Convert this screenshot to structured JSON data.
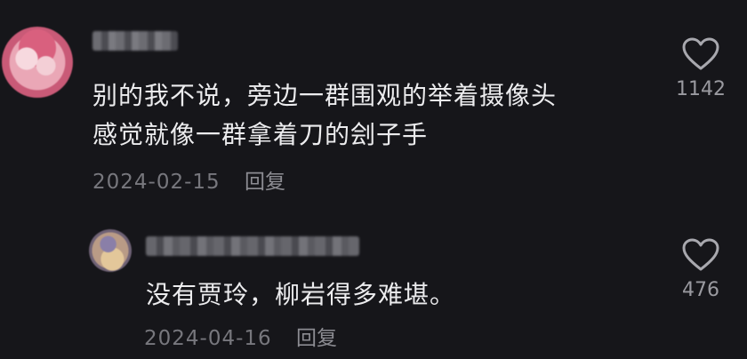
{
  "comments": [
    {
      "avatar_icon": "avatar-image",
      "username_obscured": true,
      "text_lines": [
        "别的我不说，旁边一群围观的举着摄像头",
        "感觉就像一群拿着刀的刽子手"
      ],
      "date": "2024-02-15",
      "reply_label": "回复",
      "like_count": "1142",
      "like_icon": "heart-outline-icon"
    },
    {
      "avatar_icon": "avatar-image",
      "username_obscured": true,
      "text_lines": [
        "没有贾玲，柳岩得多难堪。"
      ],
      "date": "2024-04-16",
      "reply_label": "回复",
      "like_count": "476",
      "like_icon": "heart-outline-icon"
    }
  ],
  "colors": {
    "background": "#16161a",
    "text": "#ececee",
    "meta": "#77777d"
  }
}
